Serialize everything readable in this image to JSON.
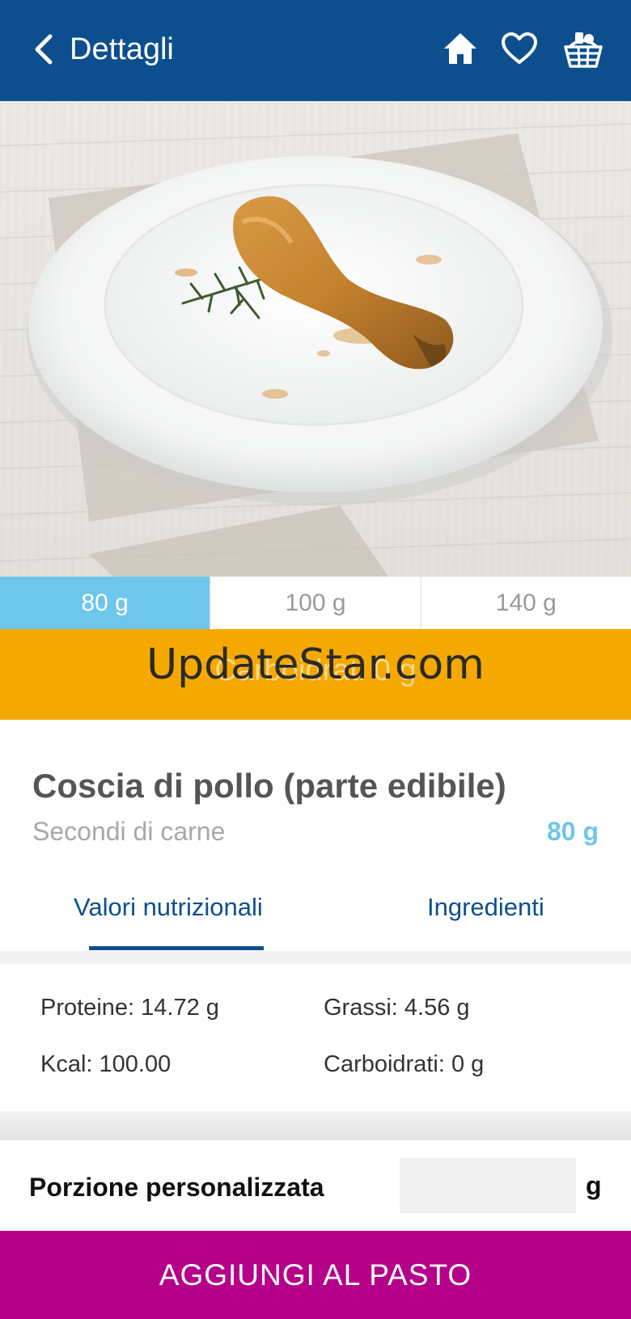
{
  "header": {
    "title": "Dettagli",
    "back_icon": "chevron-left-icon",
    "actions": [
      "home-icon",
      "heart-icon",
      "basket-icon"
    ],
    "background": "#0d4f8e"
  },
  "portion_tabs": [
    {
      "label": "80 g",
      "selected": true
    },
    {
      "label": "100 g",
      "selected": false
    },
    {
      "label": "140 g",
      "selected": false
    }
  ],
  "banner": {
    "text": "Carboidrati 0 g",
    "watermark": "UpdateStar.com",
    "color": "#f5a800"
  },
  "food": {
    "name": "Coscia di pollo (parte edibile)",
    "category": "Secondi di carne",
    "portion": "80 g"
  },
  "info_tabs": [
    {
      "label": "Valori nutrizionali",
      "selected": true
    },
    {
      "label": "Ingredienti",
      "selected": false
    }
  ],
  "nutrition": {
    "proteins": "Proteine: 14.72 g",
    "fats": "Grassi: 4.56 g",
    "kcal": "Kcal: 100.00",
    "carbs": "Carboidrati: 0 g"
  },
  "custom_portion": {
    "label": "Porzione personalizzata",
    "value": "",
    "unit": "g"
  },
  "add_button": {
    "label": "AGGIUNGI AL PASTO",
    "color": "#b5008a"
  },
  "colors": {
    "accent_light": "#6ec6ea",
    "primary": "#0d4f8e"
  }
}
